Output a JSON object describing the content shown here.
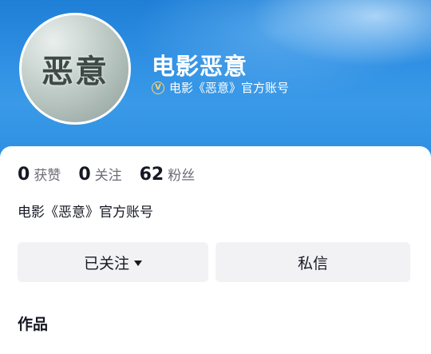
{
  "profile": {
    "avatar_text": "恶意",
    "name": "电影恶意",
    "verified_label": "电影《恶意》官方账号",
    "verified_icon": "verified-v-icon"
  },
  "stats": [
    {
      "value": "0",
      "label": "获赞"
    },
    {
      "value": "0",
      "label": "关注"
    },
    {
      "value": "62",
      "label": "粉丝"
    }
  ],
  "bio": "电影《恶意》官方账号",
  "actions": {
    "follow_label": "已关注",
    "follow_icon": "caret-down-icon",
    "message_label": "私信"
  },
  "section": {
    "title": "作品"
  },
  "colors": {
    "banner_blue": "#2f8fe3",
    "verified_gold": "#ffd66b",
    "button_bg": "#f2f2f4",
    "text_primary": "#161823",
    "text_secondary": "#6b6d75"
  }
}
